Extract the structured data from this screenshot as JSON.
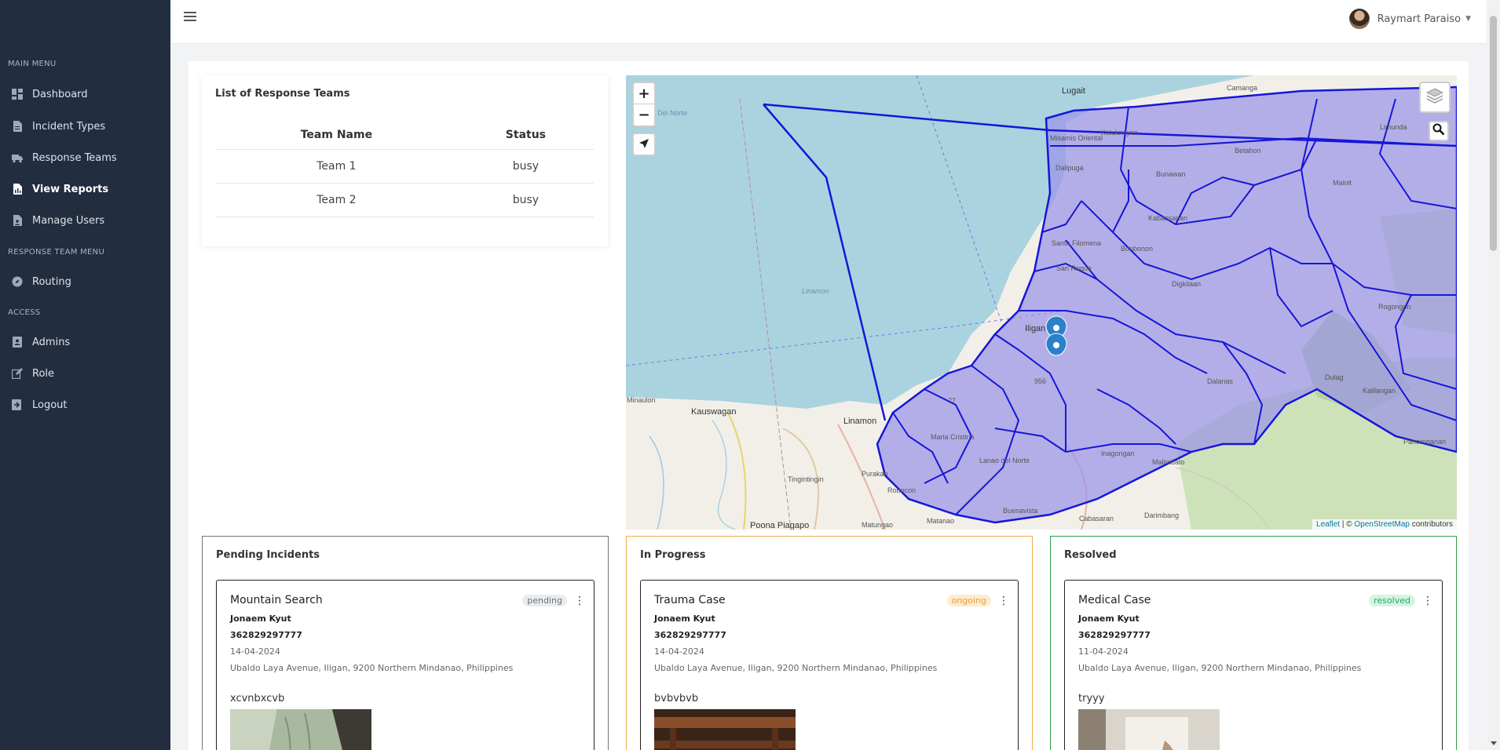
{
  "sidebar": {
    "sections": [
      {
        "label": "MAIN MENU"
      },
      {
        "label": "RESPONSE TEAM MENU"
      },
      {
        "label": "ACCESS"
      }
    ],
    "items": [
      {
        "label": "Dashboard",
        "icon": "dashboard-icon"
      },
      {
        "label": "Incident Types",
        "icon": "file-icon"
      },
      {
        "label": "Response Teams",
        "icon": "truck-icon"
      },
      {
        "label": "View Reports",
        "icon": "report-icon",
        "active": true
      },
      {
        "label": "Manage Users",
        "icon": "users-file-icon"
      },
      {
        "label": "Routing",
        "icon": "compass-icon"
      },
      {
        "label": "Admins",
        "icon": "id-card-icon"
      },
      {
        "label": "Role",
        "icon": "edit-icon"
      },
      {
        "label": "Logout",
        "icon": "logout-icon"
      }
    ]
  },
  "header": {
    "user_name": "Raymart Paraiso"
  },
  "teams": {
    "title": "List of Response Teams",
    "columns": [
      "Team Name",
      "Status"
    ],
    "rows": [
      {
        "name": "Team 1",
        "status": "busy"
      },
      {
        "name": "Team 2",
        "status": "busy"
      }
    ]
  },
  "map": {
    "zoom_in": "+",
    "zoom_out": "−",
    "attribution_leaflet": "Leaflet",
    "attribution_sep": " | © ",
    "attribution_osm": "OpenStreetMap",
    "attribution_suffix": " contributors",
    "places": {
      "lugait": "Lugait",
      "camanga": "Camanga",
      "kaluknayan": "Kaluknayan",
      "limunda": "Limunda",
      "betahon": "Betahon",
      "bunawan": "Bunawan",
      "dalipuga": "Dalipuga",
      "mainit": "Mainit",
      "kabacsanan": "Kabacsanan",
      "bonbonon": "Bonbonon",
      "santa_filomena": "Santa Filomena",
      "san_roque": "San Roque",
      "digkilaan": "Digkilaan",
      "rogongon": "Rogongon",
      "iligan": "Iligan",
      "linamon_sea": "Linamon",
      "linamon": "Linamon",
      "kauswagan": "Kauswagan",
      "minaulon": "Minaulon",
      "dalanas": "Dalanas",
      "dulag": "Dulag",
      "kalilangan": "Kalilangan",
      "purakan": "Purakan",
      "robocon": "Robocon",
      "tingintingin": "Tingintingin",
      "malimbato": "Malimbato",
      "inagongan": "Inagongan",
      "buenavista": "Buenavista",
      "cabasaran": "Cabasaran",
      "darimbang": "Darimbang",
      "poona_piagapo": "Poona Piagapo",
      "matungao": "Matungao",
      "maria_cristina": "Maria Cristina",
      "lanao_del_norte": "Lanao del Norte",
      "dei_norte": "Dei Norte",
      "misamis_oriental": "Misamis Oriental",
      "route_956": "956",
      "route_77": "77",
      "matanao": "Matanao",
      "panoroganan": "Panoroganan"
    }
  },
  "columns": [
    {
      "title": "Pending Incidents",
      "border_color": "#6c757d",
      "card": {
        "title": "Mountain Search",
        "badge": "pending",
        "badge_bg": "#e9ecef",
        "badge_color": "#6c757d",
        "name": "Jonaem Kyut",
        "phone": "362829297777",
        "date": "14-04-2024",
        "address": "Ubaldo Laya Avenue, Iligan, 9200 Northern Mindanao, Philippines",
        "description": "xcvnbxcvb"
      }
    },
    {
      "title": "In Progress",
      "border_color": "#f0ad4e",
      "card": {
        "title": "Trauma Case",
        "badge": "ongoing",
        "badge_bg": "#fdebd0",
        "badge_color": "#e8a23a",
        "name": "Jonaem Kyut",
        "phone": "362829297777",
        "date": "14-04-2024",
        "address": "Ubaldo Laya Avenue, Iligan, 9200 Northern Mindanao, Philippines",
        "description": "bvbvbvb"
      }
    },
    {
      "title": "Resolved",
      "border_color": "#2e9d4a",
      "card": {
        "title": "Medical Case",
        "badge": "resolved",
        "badge_bg": "#d4f4e2",
        "badge_color": "#28a86b",
        "name": "Jonaem Kyut",
        "phone": "362829297777",
        "date": "11-04-2024",
        "address": "Ubaldo Laya Avenue, Iligan, 9200 Northern Mindanao, Philippines",
        "description": "tryyy"
      }
    }
  ]
}
